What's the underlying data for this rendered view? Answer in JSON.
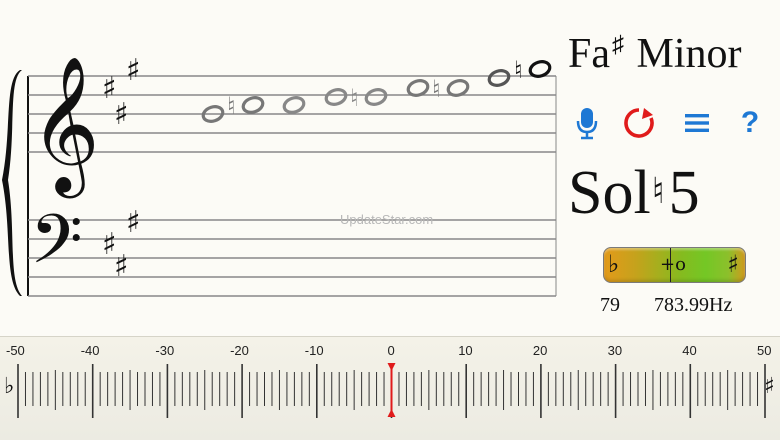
{
  "key": {
    "note": "Fa",
    "accidental": "♯",
    "mode": "Minor"
  },
  "toolbar": {
    "mic_icon": "microphone-icon",
    "refresh_icon": "refresh-icon",
    "menu_icon": "menu-icon",
    "help_icon": "help-icon",
    "help_glyph": "?",
    "accent_color": "#1e78d4",
    "refresh_color": "#e01b1b"
  },
  "current_note": {
    "name": "Sol",
    "accidental": "♮",
    "octave": "5"
  },
  "tuner": {
    "flat_symbol": "♭",
    "sharp_symbol": "♯",
    "center_mark": "+o",
    "deviation_cents": 0
  },
  "readout": {
    "midi_number": "79",
    "frequency": "783.99Hz"
  },
  "watermark": "UpdateStar.com",
  "cents_ruler": {
    "labels": [
      "-50",
      "-40",
      "-30",
      "-20",
      "-10",
      "0",
      "10",
      "20",
      "30",
      "40",
      "50"
    ],
    "flat_symbol": "♭",
    "sharp_symbol": "♯",
    "needle_value": 0,
    "needle_color": "#e01b1b"
  },
  "staff": {
    "clefs": [
      "treble-clef",
      "bass-clef"
    ],
    "key_signature": "F♯ minor (3 sharps)",
    "scale_note_count": 12
  }
}
